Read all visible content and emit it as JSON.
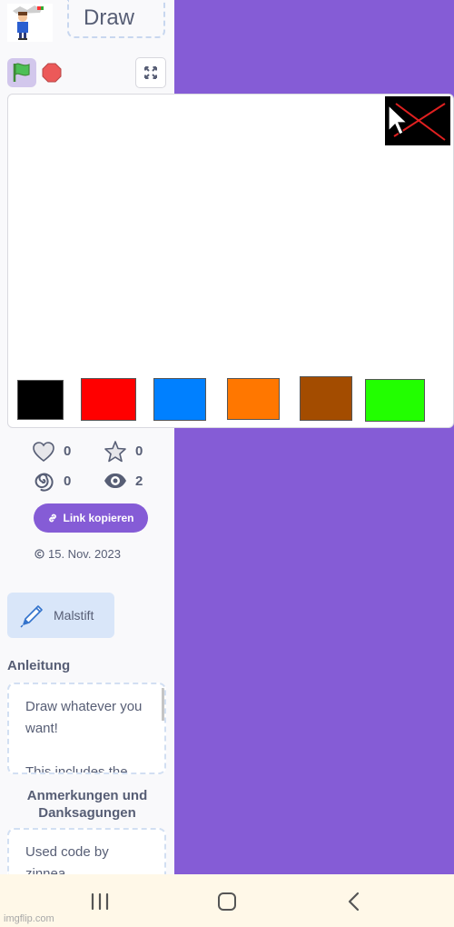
{
  "project": {
    "title": "Draw"
  },
  "stats": {
    "likes": "0",
    "favorites": "0",
    "remixes": "0",
    "views": "2"
  },
  "actions": {
    "copy_link_label": "Link kopieren"
  },
  "meta": {
    "date": "15. Nov. 2023"
  },
  "tag": {
    "label": "Malstift"
  },
  "instructions": {
    "heading": "Anleitung",
    "text_lines": [
      "Draw whatever you",
      "want!",
      "",
      "This includes the"
    ]
  },
  "notes": {
    "heading_line1": "Anmerkungen und",
    "heading_line2": "Danksagungen",
    "text_lines": [
      "Used code by",
      "zinnea"
    ]
  },
  "palette": {
    "colors": [
      "#000000",
      "#ff0000",
      "#0080ff",
      "#ff7700",
      "#a34c00",
      "#22ff00"
    ]
  },
  "theme": {
    "accent": "#855cd6",
    "text": "#575e75"
  },
  "watermark": "imgflip.com"
}
